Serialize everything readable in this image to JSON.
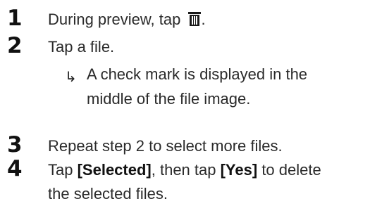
{
  "steps": [
    {
      "number": "1",
      "text_before": "During preview, tap ",
      "icon": "trash-icon",
      "text_after": "."
    },
    {
      "number": "2",
      "text": "Tap a file.",
      "result_arrow": "↳",
      "result_lines": [
        "A check mark is displayed in the",
        "middle of the file image."
      ]
    },
    {
      "number": "3",
      "text": "Repeat step 2 to select more files."
    },
    {
      "number": "4",
      "line1_part1": "Tap ",
      "line1_bold1": "[Selected]",
      "line1_part2": ", then tap ",
      "line1_bold2": "[Yes]",
      "line1_part3": " to delete",
      "line2": "the selected files."
    }
  ]
}
